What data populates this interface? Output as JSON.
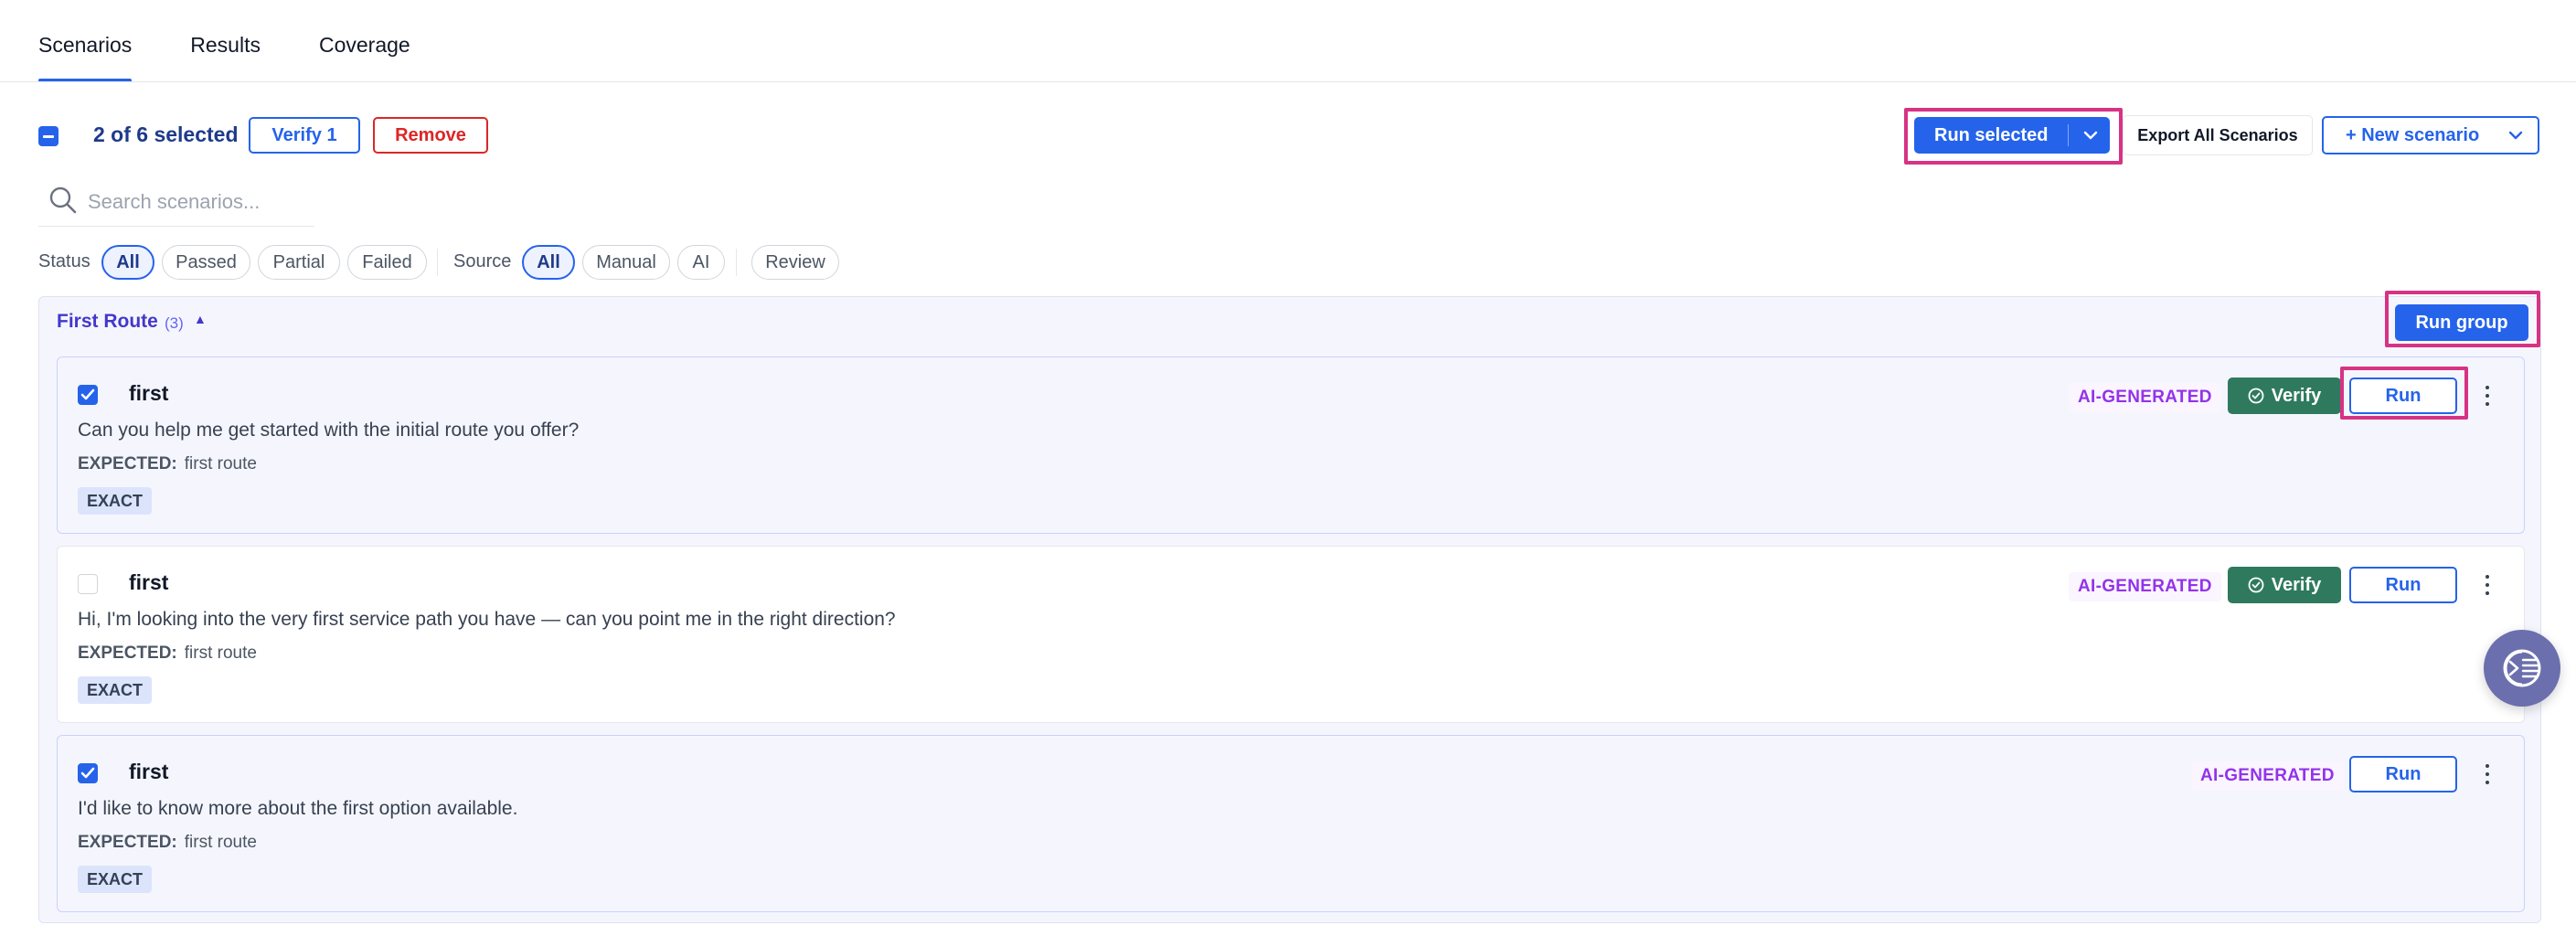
{
  "tabs": [
    {
      "label": "Scenarios",
      "active": true
    },
    {
      "label": "Results",
      "active": false
    },
    {
      "label": "Coverage",
      "active": false
    }
  ],
  "toolbar": {
    "selected_text": "2 of 6 selected",
    "verify_label": "Verify 1",
    "remove_label": "Remove",
    "run_selected_label": "Run selected",
    "export_label": "Export All Scenarios",
    "new_scenario_label": "+ New scenario"
  },
  "search": {
    "placeholder": "Search scenarios...",
    "value": ""
  },
  "filters": {
    "status_label": "Status",
    "status_options": [
      "All",
      "Passed",
      "Partial",
      "Failed"
    ],
    "status_selected": "All",
    "source_label": "Source",
    "source_options": [
      "All",
      "Manual",
      "AI"
    ],
    "source_selected": "All",
    "review_label": "Review"
  },
  "group": {
    "title": "First Route",
    "count": "(3)",
    "run_group_label": "Run group"
  },
  "scenarios": [
    {
      "checked": true,
      "name": "first",
      "prompt": "Can you help me get started with the initial route you offer?",
      "expected_label": "EXPECTED:",
      "expected_value": "first route",
      "match_tag": "EXACT",
      "source_badge": "AI-GENERATED",
      "verify_label": "Verify",
      "run_label": "Run"
    },
    {
      "checked": false,
      "name": "first",
      "prompt": "Hi, I'm looking into the very first service path you have — can you point me in the right direction?",
      "expected_label": "EXPECTED:",
      "expected_value": "first route",
      "match_tag": "EXACT",
      "source_badge": "AI-GENERATED",
      "verify_label": "Verify",
      "run_label": "Run"
    },
    {
      "checked": true,
      "name": "first",
      "prompt": "I'd like to know more about the first option available.",
      "expected_label": "EXPECTED:",
      "expected_value": "first route",
      "match_tag": "EXACT",
      "source_badge": "AI-GENERATED",
      "run_label": "Run"
    }
  ],
  "colors": {
    "accent": "#2563eb",
    "danger": "#dc2626",
    "verify_green": "#2f7a5e",
    "ai_purple": "#9333ea",
    "highlight": "#d63384"
  },
  "icons": {
    "search": "search-icon",
    "chevron": "chevron-down-icon",
    "check": "check-circle-icon",
    "kebab": "more-vertical-icon",
    "assistant": "assistant-icon"
  }
}
